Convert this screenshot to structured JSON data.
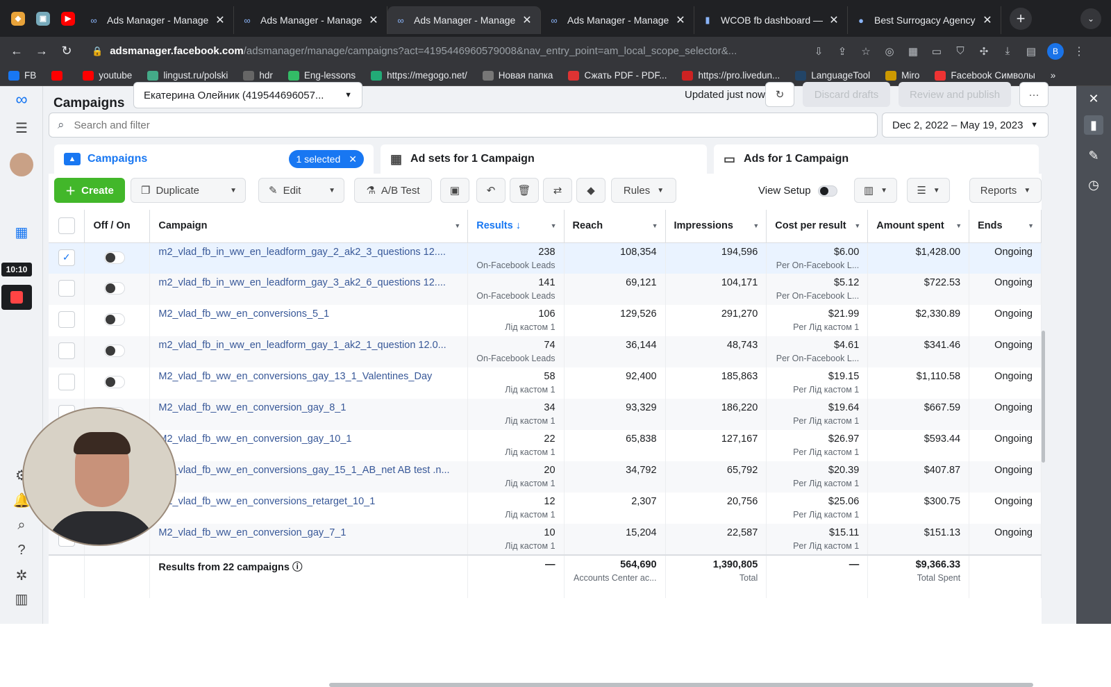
{
  "browser": {
    "tabs": [
      {
        "title": "Ads Manager - Manage",
        "active": false
      },
      {
        "title": "Ads Manager - Manage",
        "active": false
      },
      {
        "title": "Ads Manager - Manage",
        "active": true
      },
      {
        "title": "Ads Manager - Manage",
        "active": false
      },
      {
        "title": "WCOB fb dashboard —",
        "active": false
      },
      {
        "title": "Best Surrogacy Agency",
        "active": false
      }
    ],
    "url_host": "adsmanager.facebook.com",
    "url_rest": "/adsmanager/manage/campaigns?act=4195446960579008&nav_entry_point=am_local_scope_selector&...",
    "profile_letter": "B",
    "bookmarks": [
      "FB",
      "",
      "youtube",
      "lingust.ru/polski",
      "hdr",
      "Eng-lessons",
      "https://megogo.net/",
      "Новая папка",
      "Сжать PDF - PDF...",
      "https://pro.livedun...",
      "LanguageTool",
      "Miro",
      "Facebook Символы"
    ]
  },
  "recording": {
    "time": "10:10"
  },
  "header": {
    "title": "Campaigns",
    "account": "Екатерина Олейник (419544696057...",
    "updated": "Updated just now",
    "discard": "Discard drafts",
    "review": "Review and publish",
    "more": "···"
  },
  "search": {
    "placeholder": "Search and filter"
  },
  "date_range": "Dec 2, 2022 – May 19, 2023",
  "level_tabs": {
    "campaigns": "Campaigns",
    "selected": "1 selected",
    "adsets": "Ad sets for 1 Campaign",
    "ads": "Ads for 1 Campaign"
  },
  "toolbar": {
    "create": "Create",
    "duplicate": "Duplicate",
    "edit": "Edit",
    "ab_test": "A/B Test",
    "rules": "Rules",
    "view_setup": "View Setup",
    "reports": "Reports"
  },
  "columns": [
    "Off / On",
    "Campaign",
    "Results",
    "Reach",
    "Impressions",
    "Cost per result",
    "Amount spent",
    "Ends"
  ],
  "rows": [
    {
      "name": "m2_vlad_fb_in_ww_en_leadform_gay_2_ak2_3_questions 12....",
      "results": "238",
      "results_sub": "On-Facebook Leads",
      "reach": "108,354",
      "impressions": "194,596",
      "cpr": "$6.00",
      "cpr_sub": "Per On-Facebook L...",
      "spent": "$1,428.00",
      "ends": "Ongoing",
      "selected": true
    },
    {
      "name": "m2_vlad_fb_in_ww_en_leadform_gay_3_ak2_6_questions 12....",
      "results": "141",
      "results_sub": "On-Facebook Leads",
      "reach": "69,121",
      "impressions": "104,171",
      "cpr": "$5.12",
      "cpr_sub": "Per On-Facebook L...",
      "spent": "$722.53",
      "ends": "Ongoing",
      "selected": false
    },
    {
      "name": "M2_vlad_fb_ww_en_conversions_5_1",
      "results": "106",
      "results_sub": "Лід кастом 1",
      "reach": "129,526",
      "impressions": "291,270",
      "cpr": "$21.99",
      "cpr_sub": "Per Лід кастом 1",
      "spent": "$2,330.89",
      "ends": "Ongoing",
      "selected": false
    },
    {
      "name": "m2_vlad_fb_in_ww_en_leadform_gay_1_ak2_1_question 12.0...",
      "results": "74",
      "results_sub": "On-Facebook Leads",
      "reach": "36,144",
      "impressions": "48,743",
      "cpr": "$4.61",
      "cpr_sub": "Per On-Facebook L...",
      "spent": "$341.46",
      "ends": "Ongoing",
      "selected": false
    },
    {
      "name": "M2_vlad_fb_ww_en_conversions_gay_13_1_Valentines_Day",
      "results": "58",
      "results_sub": "Лід кастом 1",
      "reach": "92,400",
      "impressions": "185,863",
      "cpr": "$19.15",
      "cpr_sub": "Per Лід кастом 1",
      "spent": "$1,110.58",
      "ends": "Ongoing",
      "selected": false
    },
    {
      "name": "M2_vlad_fb_ww_en_conversion_gay_8_1",
      "results": "34",
      "results_sub": "Лід кастом 1",
      "reach": "93,329",
      "impressions": "186,220",
      "cpr": "$19.64",
      "cpr_sub": "Per Лід кастом 1",
      "spent": "$667.59",
      "ends": "Ongoing",
      "selected": false
    },
    {
      "name": "M2_vlad_fb_ww_en_conversion_gay_10_1",
      "results": "22",
      "results_sub": "Лід кастом 1",
      "reach": "65,838",
      "impressions": "127,167",
      "cpr": "$26.97",
      "cpr_sub": "Per Лід кастом 1",
      "spent": "$593.44",
      "ends": "Ongoing",
      "selected": false
    },
    {
      "name": "M2_vlad_fb_ww_en_conversions_gay_15_1_AB_net AB test .n...",
      "results": "20",
      "results_sub": "Лід кастом 1",
      "reach": "34,792",
      "impressions": "65,792",
      "cpr": "$20.39",
      "cpr_sub": "Per Лід кастом 1",
      "spent": "$407.87",
      "ends": "Ongoing",
      "selected": false
    },
    {
      "name": "M2_vlad_fb_ww_en_conversions_retarget_10_1",
      "results": "12",
      "results_sub": "Лід кастом 1",
      "reach": "2,307",
      "impressions": "20,756",
      "cpr": "$25.06",
      "cpr_sub": "Per Лід кастом 1",
      "spent": "$300.75",
      "ends": "Ongoing",
      "selected": false
    },
    {
      "name": "M2_vlad_fb_ww_en_conversion_gay_7_1",
      "results": "10",
      "results_sub": "Лід кастом 1",
      "reach": "15,204",
      "impressions": "22,587",
      "cpr": "$15.11",
      "cpr_sub": "Per Лід кастом 1",
      "spent": "$151.13",
      "ends": "Ongoing",
      "selected": false
    }
  ],
  "totals": {
    "label": "Results from 22 campaigns",
    "results": "—",
    "reach": "564,690",
    "reach_sub": "Accounts Center ac...",
    "impressions": "1,390,805",
    "impressions_sub": "Total",
    "cpr": "—",
    "spent": "$9,366.33",
    "spent_sub": "Total Spent"
  },
  "colors": {
    "accent": "#1877f2",
    "create": "#42b72a",
    "link": "#385898"
  }
}
